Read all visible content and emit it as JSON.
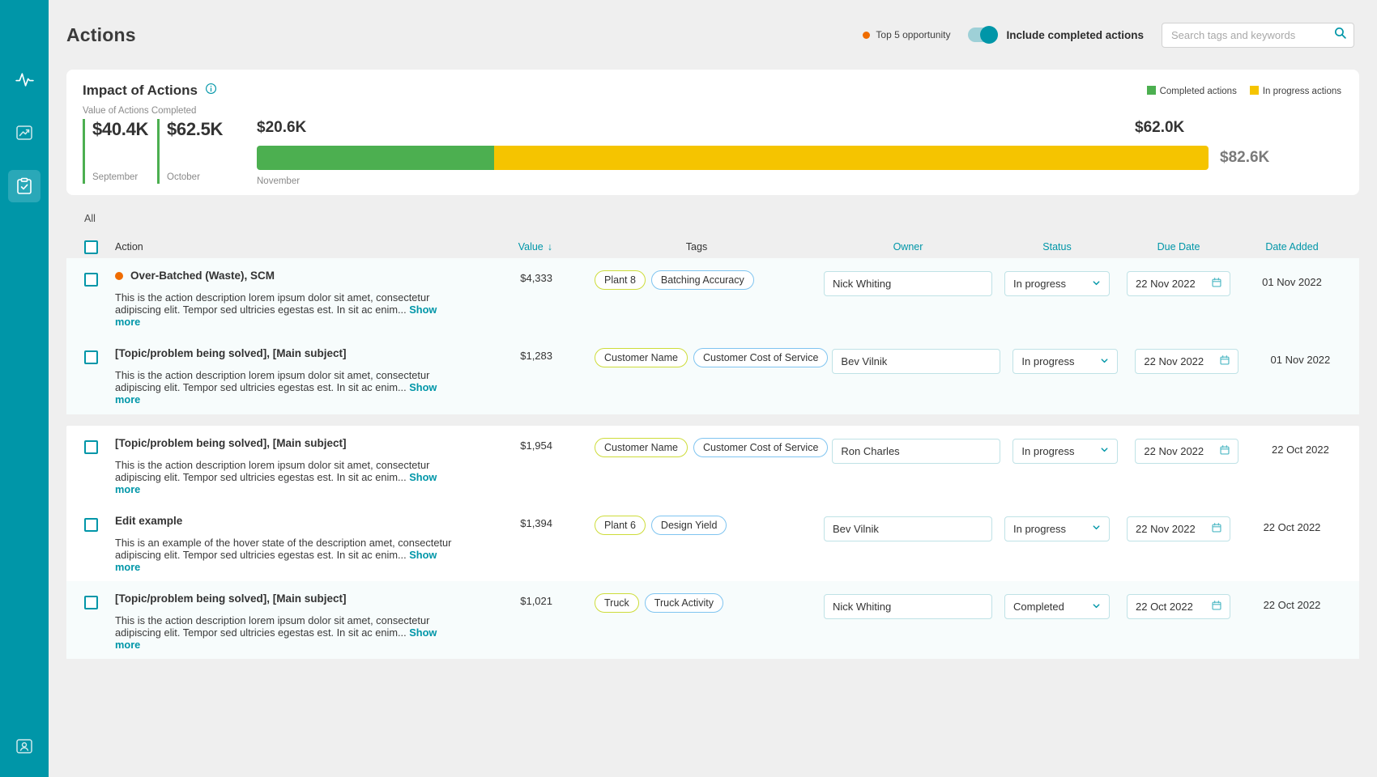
{
  "sidebar": {
    "items": [
      {
        "name": "pulse-icon",
        "label": "Pulse",
        "active": false
      },
      {
        "name": "analytics-icon",
        "label": "Analytics",
        "active": false
      },
      {
        "name": "actions-icon",
        "label": "Actions",
        "active": true
      }
    ],
    "bottom": {
      "name": "account-icon",
      "label": "Account"
    }
  },
  "header": {
    "title": "Actions",
    "opportunity_legend": "Top 5 opportunity",
    "toggle_label": "Include completed actions",
    "toggle_on": true,
    "search_placeholder": "Search tags and keywords",
    "search_value": ""
  },
  "impact_card": {
    "title": "Impact of Actions",
    "subtitle": "Value of Actions Completed",
    "legend": [
      {
        "label": "Completed actions",
        "color": "#4caf50"
      },
      {
        "label": "In progress actions",
        "color": "#f5c400"
      }
    ]
  },
  "chart_data": {
    "type": "bar",
    "title": "Impact of Actions",
    "subtitle": "Value of Actions Completed",
    "categories": [
      "September",
      "October",
      "November"
    ],
    "series": [
      {
        "name": "Completed actions",
        "color": "#4caf50",
        "values": [
          40400,
          62500,
          20600
        ]
      },
      {
        "name": "In progress actions",
        "color": "#f5c400",
        "values": [
          null,
          null,
          62000
        ]
      }
    ],
    "past_months": [
      {
        "label": "September",
        "value_text": "$40.4K",
        "value": 40400
      },
      {
        "label": "October",
        "value_text": "$62.5K",
        "value": 62500
      }
    ],
    "current_month": {
      "label": "November",
      "completed_text": "$20.6K",
      "completed": 20600,
      "in_progress_text": "$62.0K",
      "in_progress": 62000,
      "total_text": "$82.6K",
      "total": 82600
    },
    "legend_position": "top-right",
    "grid": false,
    "xlabel": "",
    "ylabel": ""
  },
  "table": {
    "filter_label": "All",
    "columns": {
      "action": "Action",
      "value": "Value",
      "sort_arrow": "↓",
      "tags": "Tags",
      "owner": "Owner",
      "status": "Status",
      "due_date": "Due Date",
      "date_added": "Date Added"
    },
    "groups": [
      {
        "rows": [
          {
            "title": "Over-Batched (Waste), SCM",
            "opportunity": true,
            "description": "This is the action description lorem ipsum dolor sit amet, consectetur adipiscing elit. Tempor sed ultricies egestas est. In sit ac enim...",
            "show_more": "Show more",
            "value": "$4,333",
            "tags": [
              {
                "label": "Plant 8",
                "style": "yellow"
              },
              {
                "label": "Batching Accuracy",
                "style": "blue"
              }
            ],
            "owner": "Nick Whiting",
            "status": "In progress",
            "due_date": "22 Nov 2022",
            "date_added": "01 Nov 2022",
            "shaded": true
          },
          {
            "title": "[Topic/problem being solved], [Main subject]",
            "opportunity": false,
            "description": "This is the action description lorem ipsum dolor sit amet, consectetur adipiscing elit. Tempor sed ultricies egestas est. In sit ac enim...",
            "show_more": "Show more",
            "value": "$1,283",
            "tags": [
              {
                "label": "Customer Name",
                "style": "yellow"
              },
              {
                "label": "Customer Cost of Service",
                "style": "blue"
              }
            ],
            "owner": "Bev Vilnik",
            "status": "In progress",
            "due_date": "22 Nov 2022",
            "date_added": "01 Nov 2022",
            "shaded": true
          }
        ]
      },
      {
        "rows": [
          {
            "title": "[Topic/problem being solved], [Main subject]",
            "opportunity": false,
            "description": "This is the action description lorem ipsum dolor sit amet, consectetur adipiscing elit. Tempor sed ultricies egestas est. In sit ac enim...",
            "show_more": "Show more",
            "value": "$1,954",
            "tags": [
              {
                "label": "Customer Name",
                "style": "yellow"
              },
              {
                "label": "Customer Cost of Service",
                "style": "blue"
              }
            ],
            "owner": "Ron Charles",
            "status": "In progress",
            "due_date": "22 Nov 2022",
            "date_added": "22 Oct 2022",
            "shaded": false
          },
          {
            "title": "Edit example",
            "opportunity": false,
            "description": "This is an example of the hover state of the description amet, consectetur adipiscing elit. Tempor sed ultricies egestas est. In sit ac enim...",
            "show_more": "Show more",
            "value": "$1,394",
            "tags": [
              {
                "label": "Plant 6",
                "style": "yellow"
              },
              {
                "label": "Design Yield",
                "style": "blue"
              }
            ],
            "owner": "Bev Vilnik",
            "status": "In progress",
            "due_date": "22 Nov 2022",
            "date_added": "22 Oct 2022",
            "shaded": false
          },
          {
            "title": "[Topic/problem being solved], [Main subject]",
            "opportunity": false,
            "description": "This is the action description lorem ipsum dolor sit amet, consectetur adipiscing elit. Tempor sed ultricies egestas est. In sit ac enim...",
            "show_more": "Show more",
            "value": "$1,021",
            "tags": [
              {
                "label": "Truck",
                "style": "yellow"
              },
              {
                "label": "Truck Activity",
                "style": "blue"
              }
            ],
            "owner": "Nick Whiting",
            "status": "Completed",
            "due_date": "22 Oct 2022",
            "date_added": "22 Oct 2022",
            "shaded": true
          }
        ]
      }
    ]
  },
  "colors": {
    "brand_teal": "#0096a8",
    "sidebar": "#0096a8",
    "completed_green": "#4caf50",
    "inprogress_yellow": "#f5c400",
    "opportunity_orange": "#ef6c00",
    "tag_yellow_border": "#cddc39",
    "tag_blue_border": "#7fc4f0",
    "page_bg": "#efefef"
  }
}
